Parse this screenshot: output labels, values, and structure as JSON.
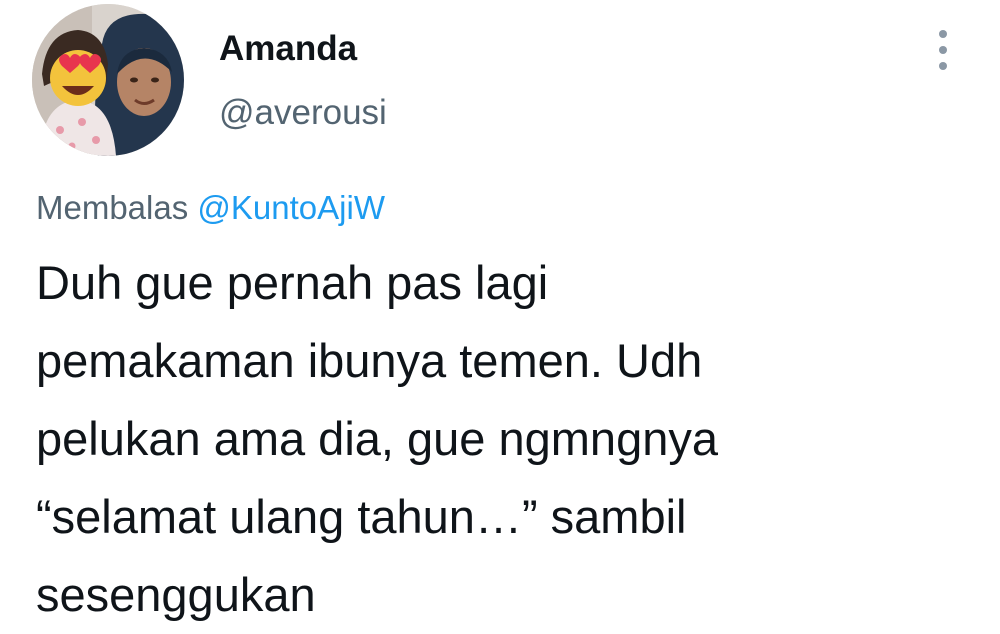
{
  "tweet": {
    "author": {
      "name": "Amanda",
      "handle": "@averousi",
      "avatar_icon": "profile-photo"
    },
    "more_icon": "more-vertical-icon",
    "reply": {
      "prefix": "Membalas",
      "mention": "@KuntoAjiW"
    },
    "text": "Duh gue pernah pas lagi\npemakaman ibunya temen. Udh\npelukan ama dia, gue ngmngnya\n“selamat ulang tahun…” sambil\nsesenggukan"
  },
  "colors": {
    "primary_text": "#0f1419",
    "secondary_text": "#536471",
    "link": "#1d9bf0",
    "icon": "#8b98a5"
  }
}
